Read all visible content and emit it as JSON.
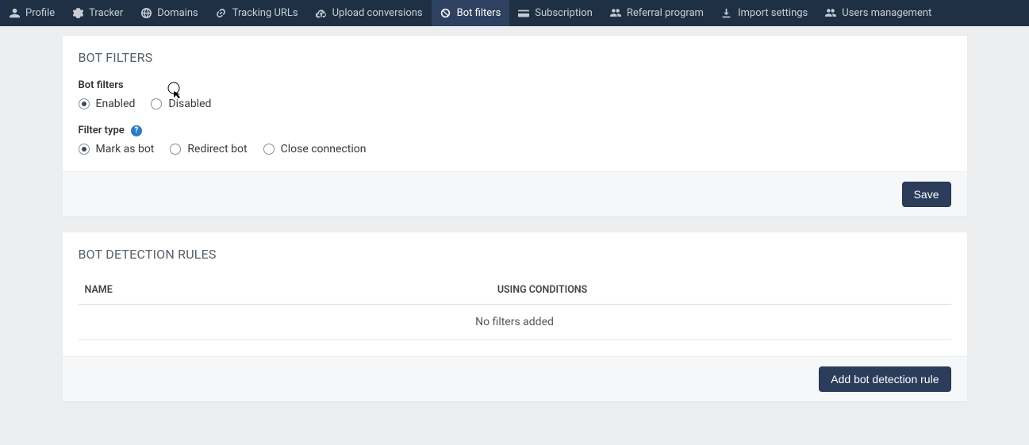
{
  "nav": {
    "items": [
      {
        "label": "Profile",
        "icon": "user"
      },
      {
        "label": "Tracker",
        "icon": "gear"
      },
      {
        "label": "Domains",
        "icon": "globe"
      },
      {
        "label": "Tracking URLs",
        "icon": "link"
      },
      {
        "label": "Upload conversions",
        "icon": "cloud-upload"
      },
      {
        "label": "Bot filters",
        "icon": "ban",
        "active": true
      },
      {
        "label": "Subscription",
        "icon": "credit-card"
      },
      {
        "label": "Referral program",
        "icon": "users"
      },
      {
        "label": "Import settings",
        "icon": "download"
      },
      {
        "label": "Users management",
        "icon": "users"
      }
    ]
  },
  "filters_panel": {
    "title": "BOT FILTERS",
    "status_label": "Bot filters",
    "status_options": {
      "enabled": "Enabled",
      "disabled": "Disabled"
    },
    "status_selected": "enabled",
    "type_label": "Filter type",
    "type_options": {
      "mark": "Mark as bot",
      "redirect": "Redirect bot",
      "close": "Close connection"
    },
    "type_selected": "mark",
    "save_label": "Save"
  },
  "rules_panel": {
    "title": "BOT DETECTION RULES",
    "col_name": "NAME",
    "col_cond": "USING CONDITIONS",
    "empty_text": "No filters added",
    "add_label": "Add bot detection rule"
  }
}
